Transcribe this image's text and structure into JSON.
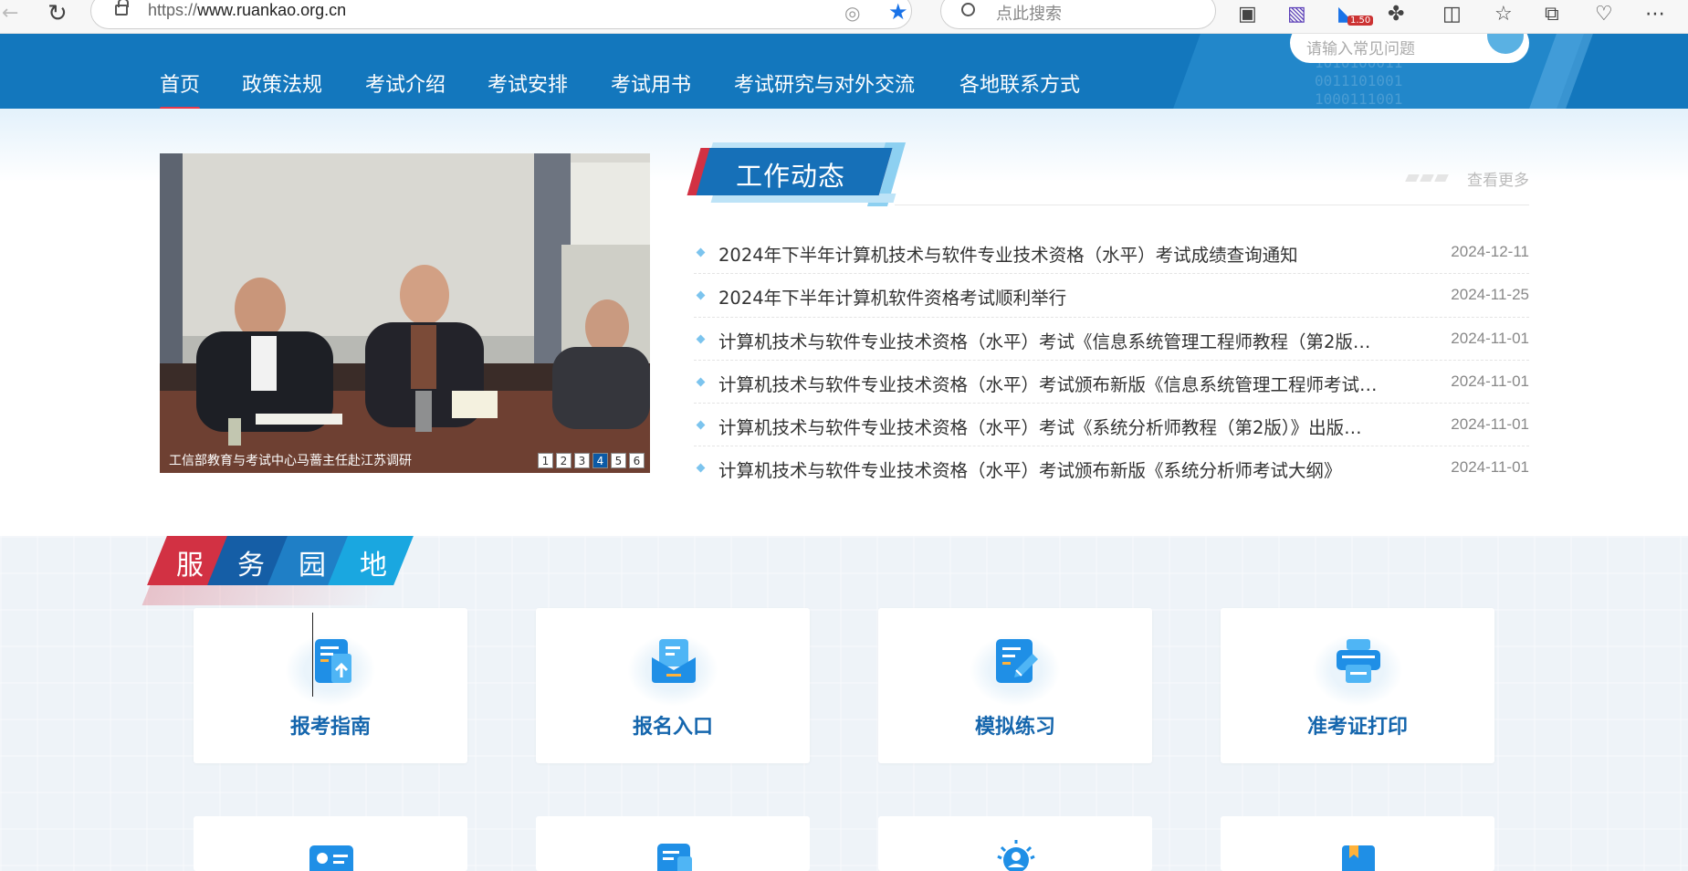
{
  "browser": {
    "url_prefix": "https://",
    "url_domain": "www.ruankao.org.cn",
    "search_placeholder": "点此搜索",
    "badge": "1.50"
  },
  "site": {
    "search_placeholder": "请输入常见问题",
    "nav": [
      "首页",
      "政策法规",
      "考试介绍",
      "考试安排",
      "考试用书",
      "考试研究与对外交流",
      "各地联系方式"
    ],
    "nav_active_index": 0
  },
  "slider": {
    "caption": "工信部教育与考试中心马蔷主任赴江苏调研",
    "pages": [
      "1",
      "2",
      "3",
      "4",
      "5",
      "6"
    ],
    "active_page": "4"
  },
  "news": {
    "title": "工作动态",
    "more": "查看更多",
    "items": [
      {
        "title": "2024年下半年计算机技术与软件专业技术资格（水平）考试成绩查询通知",
        "date": "2024-12-11"
      },
      {
        "title": "2024年下半年计算机软件资格考试顺利举行",
        "date": "2024-11-25"
      },
      {
        "title": "计算机技术与软件专业技术资格（水平）考试《信息系统管理工程师教程（第2版…",
        "date": "2024-11-01"
      },
      {
        "title": "计算机技术与软件专业技术资格（水平）考试颁布新版《信息系统管理工程师考试…",
        "date": "2024-11-01"
      },
      {
        "title": "计算机技术与软件专业技术资格（水平）考试《系统分析师教程（第2版）》出版…",
        "date": "2024-11-01"
      },
      {
        "title": "计算机技术与软件专业技术资格（水平）考试颁布新版《系统分析师考试大纲》",
        "date": "2024-11-01"
      }
    ]
  },
  "services": {
    "title_chars": [
      "服",
      "务",
      "园",
      "地"
    ],
    "cards": [
      {
        "label": "报考指南",
        "icon": "document-upload-icon"
      },
      {
        "label": "报名入口",
        "icon": "mail-inbox-icon"
      },
      {
        "label": "模拟练习",
        "icon": "pencil-note-icon"
      },
      {
        "label": "准考证打印",
        "icon": "printer-icon"
      }
    ]
  },
  "colors": {
    "nav_bg": "#1377bd",
    "accent_red": "#d23143",
    "accent_blue": "#1670b8",
    "card_label": "#1566ad"
  }
}
